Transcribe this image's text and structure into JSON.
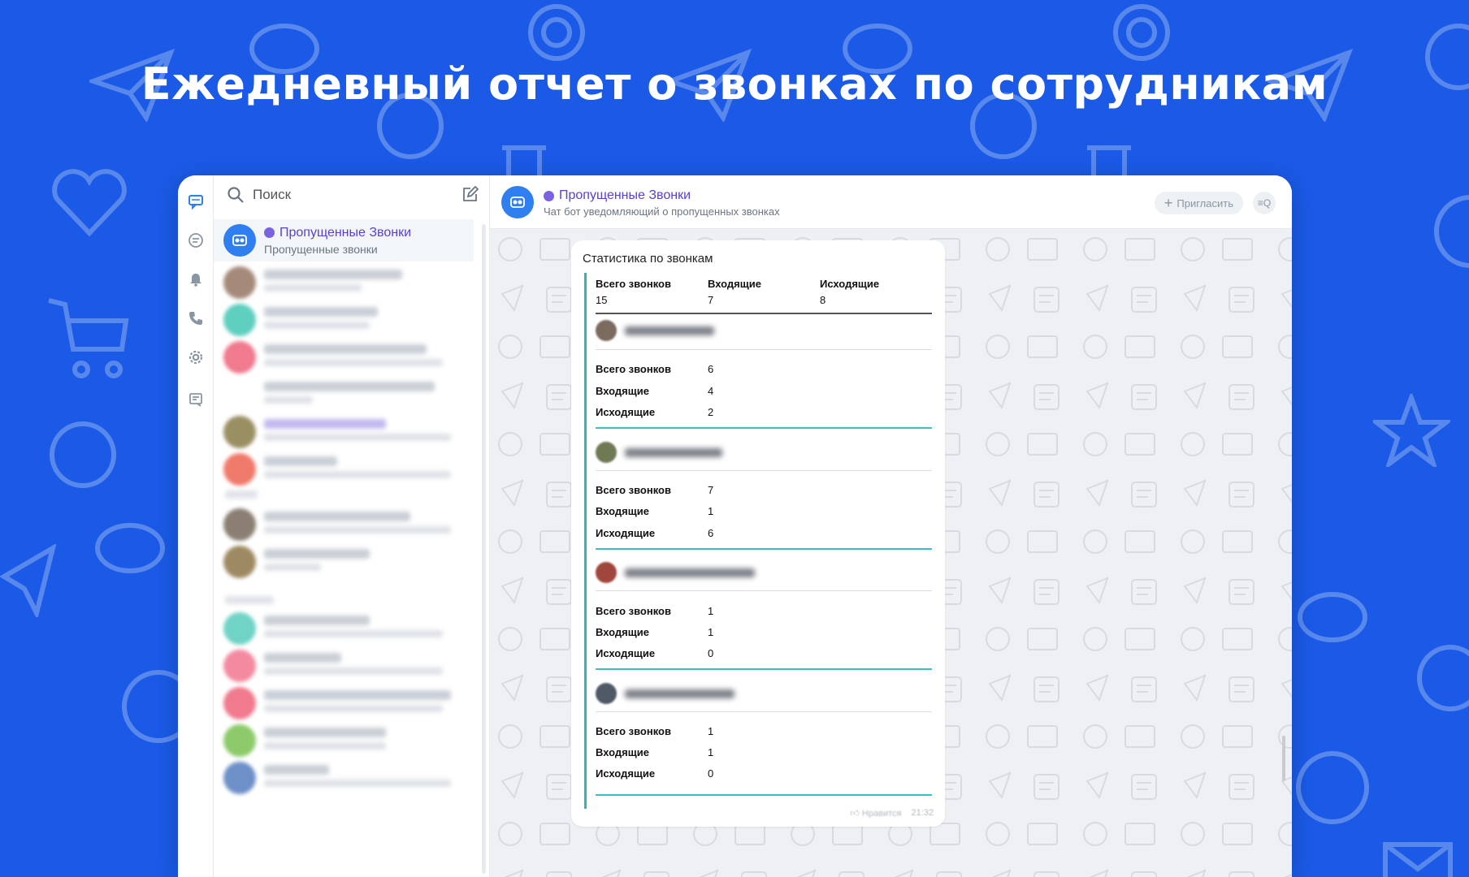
{
  "headline": "Ежедневный отчет о звонках по сотрудникам",
  "colors": {
    "background": "#1a5ae6",
    "accent": "#5a3fd1",
    "quote": "#2eb6bf"
  },
  "rail": {
    "icons": [
      "chat-icon",
      "channels-icon",
      "bell-icon",
      "phone-icon",
      "gear-icon",
      "notes-icon"
    ]
  },
  "search": {
    "placeholder": "Поиск"
  },
  "chat_list": {
    "active": {
      "title": "Пропущенные Звонки",
      "subtitle": "Пропущенные звонки"
    }
  },
  "chat_header": {
    "title": "Пропущенные Звонки",
    "subtitle": "Чат бот уведомляющий о пропущенных звонках",
    "invite_label": "Пригласить",
    "search_label": "≡Q"
  },
  "message": {
    "title": "Статистика по звонкам",
    "summary": {
      "headers": [
        "Всего звонков",
        "Входящие",
        "Исходящие"
      ],
      "values": [
        "15",
        "7",
        "8"
      ]
    },
    "stat_labels": [
      "Всего звонков",
      "Входящие",
      "Исходящие"
    ],
    "employees": [
      {
        "values": [
          "6",
          "4",
          "2"
        ]
      },
      {
        "values": [
          "7",
          "1",
          "6"
        ]
      },
      {
        "values": [
          "1",
          "1",
          "0"
        ]
      },
      {
        "values": [
          "1",
          "1",
          "0"
        ]
      }
    ],
    "like_label": "Нравится",
    "time": "21:32"
  }
}
